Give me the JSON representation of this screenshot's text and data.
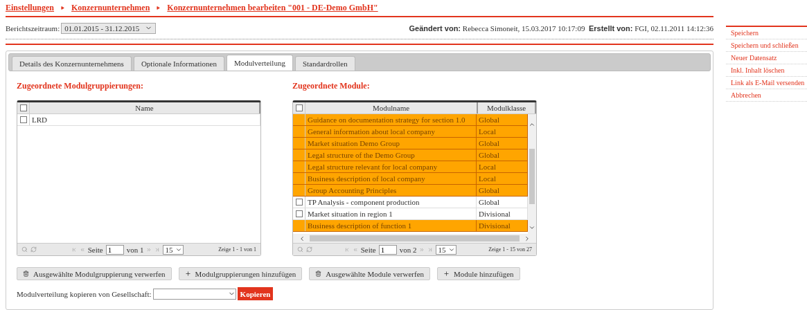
{
  "breadcrumb": [
    "Einstellungen",
    "Konzernunternehmen",
    "Konzernunternehmen bearbeiten \"001 - DE-Demo GmbH\""
  ],
  "period": {
    "label": "Berichtszeitraum:",
    "value": "01.01.2015 - 31.12.2015"
  },
  "meta": {
    "changed_label": "Geändert von:",
    "changed_value": "Rebecca Simoneit, 15.03.2017 10:17:09",
    "created_label": "Erstellt von:",
    "created_value": "FGI, 02.11.2011 14:12:36"
  },
  "sidebar_actions": [
    "Speichern",
    "Speichern und schließen",
    "Neuer Datensatz",
    "Inkl. Inhalt löschen",
    "Link als E-Mail versenden",
    "Abbrechen"
  ],
  "tabs": [
    {
      "label": "Details des Konzernunternehmens",
      "selected": false
    },
    {
      "label": "Optionale Informationen",
      "selected": false
    },
    {
      "label": "Modulverteilung",
      "selected": true
    },
    {
      "label": "Standardrollen",
      "selected": false
    }
  ],
  "groups": {
    "title": "Zugeordnete Modulgruppierungen:",
    "all_checked": false,
    "columns": [
      "Name"
    ],
    "rows": [
      {
        "name": "LRD",
        "selected": false
      }
    ],
    "pager": {
      "page_label": "Seite",
      "page": "1",
      "of": "von 1",
      "size": "15",
      "summary": "Zeige 1 - 1 von 1"
    }
  },
  "modules": {
    "title": "Zugeordnete Module:",
    "all_checked": false,
    "columns": [
      "Modulname",
      "Modulklasse"
    ],
    "rows": [
      {
        "name": "Guidance on documentation strategy for section 1.0",
        "class": "Global",
        "selected": true
      },
      {
        "name": "General information about local company",
        "class": "Local",
        "selected": true
      },
      {
        "name": "Market situation Demo Group",
        "class": "Global",
        "selected": true
      },
      {
        "name": "Legal structure of the Demo Group",
        "class": "Global",
        "selected": true
      },
      {
        "name": "Legal structure relevant for local company",
        "class": "Local",
        "selected": true
      },
      {
        "name": "Business description of local company",
        "class": "Local",
        "selected": true
      },
      {
        "name": "Group Accounting Principles",
        "class": "Global",
        "selected": true
      },
      {
        "name": "TP Analysis - component production",
        "class": "Global",
        "selected": false
      },
      {
        "name": "Market situation in region 1",
        "class": "Divisional",
        "selected": false
      },
      {
        "name": "Business description of function 1",
        "class": "Divisional",
        "selected": true
      }
    ],
    "pager": {
      "page_label": "Seite",
      "page": "1",
      "of": "von 2",
      "size": "15",
      "summary": "Zeige 1 - 15 von 27"
    }
  },
  "buttons": [
    {
      "label": "Ausgewählte Modulgruppierung verwerfen",
      "kind": "delete"
    },
    {
      "label": "Modulgruppierungen hinzufügen",
      "kind": "add"
    },
    {
      "label": "Ausgewählte Module verwerfen",
      "kind": "delete"
    },
    {
      "label": "Module hinzufügen",
      "kind": "add"
    }
  ],
  "copy": {
    "label": "Modulverteilung kopieren von Gesellschaft:",
    "button": "Kopieren"
  }
}
